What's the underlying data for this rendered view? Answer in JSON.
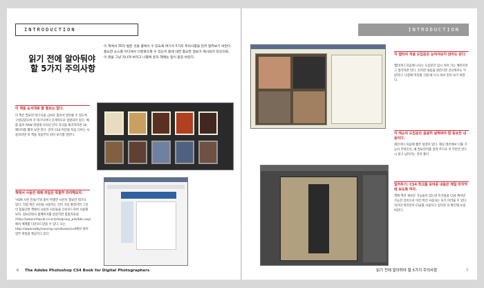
{
  "left": {
    "header": "INTRODUCTION",
    "title": "읽기 전에 알아둬야 할 5가지 주의사항",
    "intro": "이 책에서 30각 법은 것을 중에서 수 있도록 여기서 5가지 주의사항을 먼저 알려보기 바란다. 중요한 소스를 어디에서 다운로드할 수 있는지 등에 대한 중요한 정보가 제시되어 있으므로, 이 글을 그냥 지나쳐 버리고 나중에 혼자 헤매는 일이 없길 바란다.",
    "section1_title": "이 책을 순서대로 볼 필요는 없다.",
    "section1_text": "이 책은 필요한 테크닉을 금바로 찾아서 알아볼 수 있도록 구성되었으며 각 테크닉마다 단계적으로 설명되어 있다. 예를 들어 RAW 파일에 나타난 빈지 자국을 제거하려면 16 페이지를 펼쳐 보면 된다. 만약 CS4 버전을 처음 다루는 사용자라면 이 책을 처음부터 읽어 보기를 권한다.",
    "section2_title": "책에서 사용한 예제 파일은 특별히 따라해보자.",
    "section2_text": "'HDR 사진 만들기'와 같이 특별한 사진이 필요한 테크닉 있다. 직접 찍은 사진을 사용하는 것이 가장 좋겠지만 그것이 힘들다면 책에서 사용된 사진들을 다운로드하여 사용해보자. 정보문화사 홈페이지를 방문하면 통합자료실 (http://www.infopub.co.kr/pds/group_pds/bbs.asp)에서 예제를 다운로드받을 수 있다. 또는 http://www.kelbytraining.com/books/cs4에서 원어 일부 파일을 제공하고 있다.",
    "footer_num": "6",
    "footer_text": "The Adobe Photoshop CS4 Book for Digital Photographers"
  },
  "right": {
    "header": "INTRODUCTION",
    "section3_title": "각 챕터의 처음 도입문은 눈여겨보지 않아도 된다.",
    "section3_text": "챕터마다 처음에 나오는 도입문은 잠시 쉬어 가는 페이지라고 생각하면 된다. 진지한 내용을 원한다면 건너뛰어도 무방하다. 나중에 머리를 식힐 때 다시 와서 읽어 보기 바란다.",
    "section4_title": "각 레슨의 도입문은 꼼꼼히 살펴봐야 할 중요한 내용이다.",
    "section4_text": "레슨마다 처음에 짧은 설명이 있다. 해당 레슨에서 다룰 기능이 무엇인지, 왜 필요한지를 알려 주므로 이 부분은 반드시 읽고 넘어가는 것이 좋다.",
    "section5_title": "일러두기: CS4 최고를 보여준 내용은 제일 마지막에 보도록 하자.",
    "section5_text": "책에 여러 새로운 기능들이 있는데 이것들을 CS4 에서만 가능한 것이므로 이전 버전 사용자는 보기 어려울 수 있다. 하지만 여러분이 CS4를 사용하고 있다면 꼭 확인해 보길 바란다.",
    "footer_text": "읽기 전에 알아둬야 할 5가지 주의사항",
    "footer_num": "7"
  },
  "colors": {
    "accent": "#c7313a"
  }
}
